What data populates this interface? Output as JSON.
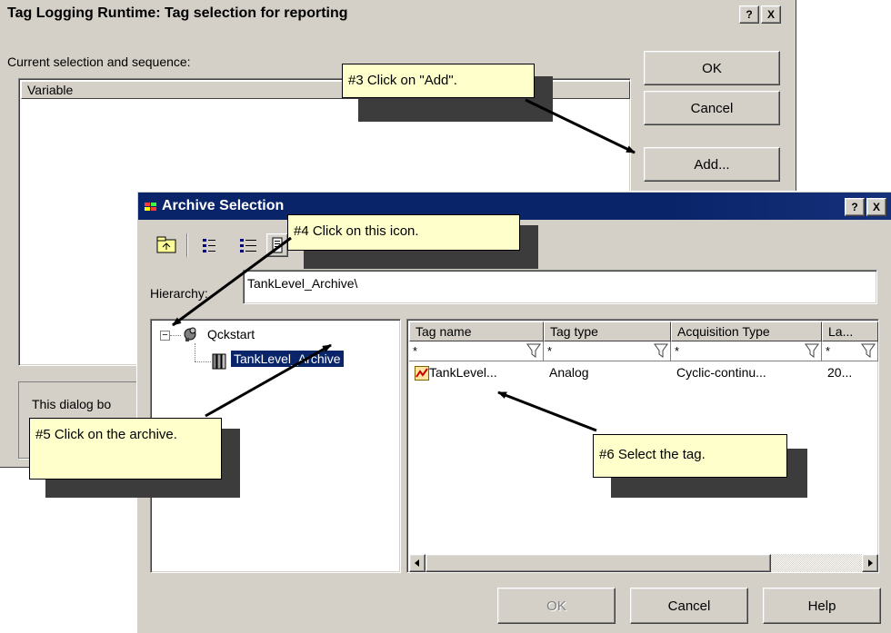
{
  "back_dialog": {
    "title": "Tag Logging Runtime: Tag selection for reporting",
    "help_btn": "?",
    "close_btn": "X",
    "current_selection_label": "Current selection and sequence:",
    "variable_header": "Variable",
    "buttons": {
      "ok": "OK",
      "cancel": "Cancel",
      "add": "Add..."
    },
    "info_text": "This dialog bo"
  },
  "archive_dialog": {
    "title": "Archive Selection",
    "help_btn": "?",
    "close_btn": "X",
    "hierarchy_label": "Hierarchy:",
    "hierarchy_value": "TankLevel_Archive\\",
    "tree": [
      {
        "label": "Qckstart",
        "icon": "archive-server-icon",
        "expand": "−"
      },
      {
        "label": "TankLevel_Archive",
        "icon": "archive-icon",
        "selected": true
      }
    ],
    "table": {
      "columns": [
        "Tag name",
        "Tag type",
        "Acquisition Type",
        "La..."
      ],
      "filters": [
        "*",
        "*",
        "*",
        "*"
      ],
      "rows": [
        {
          "tag_name": "TankLevel...",
          "tag_type": "Analog",
          "acquisition": "Cyclic-continu...",
          "last": "20..."
        }
      ]
    },
    "buttons": {
      "ok": "OK",
      "cancel": "Cancel",
      "help": "Help"
    }
  },
  "callouts": {
    "c3": "#3 Click on \"Add\".",
    "c4": "#4 Click on this icon.",
    "c5": "#5 Click on  the archive.",
    "c6": "#6 Select the tag."
  },
  "colors": {
    "title_bar": "#0a246a",
    "face": "#d4d0c8",
    "callout_bg": "#ffffcc",
    "selection": "#0a246a"
  }
}
